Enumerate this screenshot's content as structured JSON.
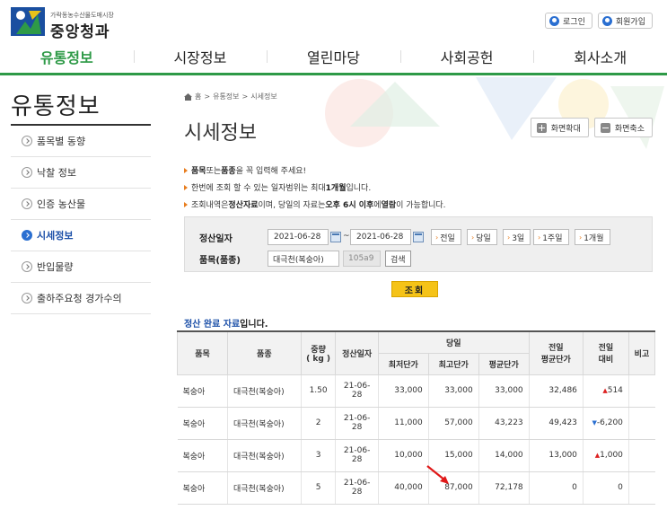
{
  "header": {
    "logo_sub": "가락동농수산물도매시장",
    "logo_name": "중앙청과",
    "login": "로그인",
    "join": "회원가입"
  },
  "gnb": [
    "유통정보",
    "시장정보",
    "열린마당",
    "사회공헌",
    "회사소개"
  ],
  "lnb": {
    "title": "유통정보",
    "items": [
      "품목별 동향",
      "낙찰 정보",
      "인증 농산물",
      "시세정보",
      "반입물량",
      "출하주요청 경가수의"
    ]
  },
  "breadcrumb": [
    "홈",
    "유통정보",
    "시세정보"
  ],
  "page_title": "시세정보",
  "zoom": {
    "in": "화면확대",
    "out": "화면축소"
  },
  "notices": [
    {
      "b1": "품목",
      "t1": " 또는 ",
      "b2": "품종",
      "t2": "을 꼭 입력해 주세요!"
    },
    {
      "b1": "",
      "t1": "한번에 조회 할 수 있는 일자범위는 최대 ",
      "b2": "1개월",
      "t2": " 입니다."
    },
    {
      "b1": "",
      "t1": "조회내역은 ",
      "b2": "정산자료",
      "t2": "이며, 당일의 자료는 ",
      "b3": "오후 6시 이후",
      "t3": " 에 ",
      "b4": "열람",
      "t4": " 이 가능합니다."
    }
  ],
  "search": {
    "date_label": "정산일자",
    "date_from": "2021-06-28",
    "tilde": "~",
    "date_to": "2021-06-28",
    "quick": [
      "전일",
      "당일",
      "3일",
      "1주일",
      "1개월"
    ],
    "item_label": "품목(품종)",
    "item_value": "대극천(복숭아)",
    "item_code": "105a9",
    "search_small": "검색",
    "search_main": "조회"
  },
  "status": {
    "hl": "정산 완료 자료",
    "rest": "입니다."
  },
  "table": {
    "headers": {
      "item": "품목",
      "variety": "품종",
      "weight": "중량\n( kg )",
      "date": "정산일자",
      "today": "당일",
      "min": "최저단가",
      "max": "최고단가",
      "avg": "평균단가",
      "prev_avg": "전일\n평균단가",
      "prev_diff": "전일\n대비",
      "note": "비고"
    },
    "rows": [
      {
        "item": "복숭아",
        "variety": "대극천(복숭아)",
        "weight": "1.50",
        "date": "21-06-28",
        "min": "33,000",
        "max": "33,000",
        "avg": "33,000",
        "prev_avg": "32,486",
        "dir": "up",
        "diff": "514"
      },
      {
        "item": "복숭아",
        "variety": "대극천(복숭아)",
        "weight": "2",
        "date": "21-06-28",
        "min": "11,000",
        "max": "57,000",
        "avg": "43,223",
        "prev_avg": "49,423",
        "dir": "down",
        "diff": "-6,200"
      },
      {
        "item": "복숭아",
        "variety": "대극천(복숭아)",
        "weight": "3",
        "date": "21-06-28",
        "min": "10,000",
        "max": "15,000",
        "avg": "14,000",
        "prev_avg": "13,000",
        "dir": "up",
        "diff": "1,000"
      },
      {
        "item": "복숭아",
        "variety": "대극천(복숭아)",
        "weight": "5",
        "date": "21-06-28",
        "min": "40,000",
        "max": "87,000",
        "avg": "72,178",
        "prev_avg": "0",
        "dir": "",
        "diff": "0"
      }
    ]
  },
  "colors": {
    "brand_green": "#2e9a47",
    "accent_blue": "#2a6fd1",
    "button_yellow": "#f5c318",
    "up_red": "#dd2222"
  }
}
